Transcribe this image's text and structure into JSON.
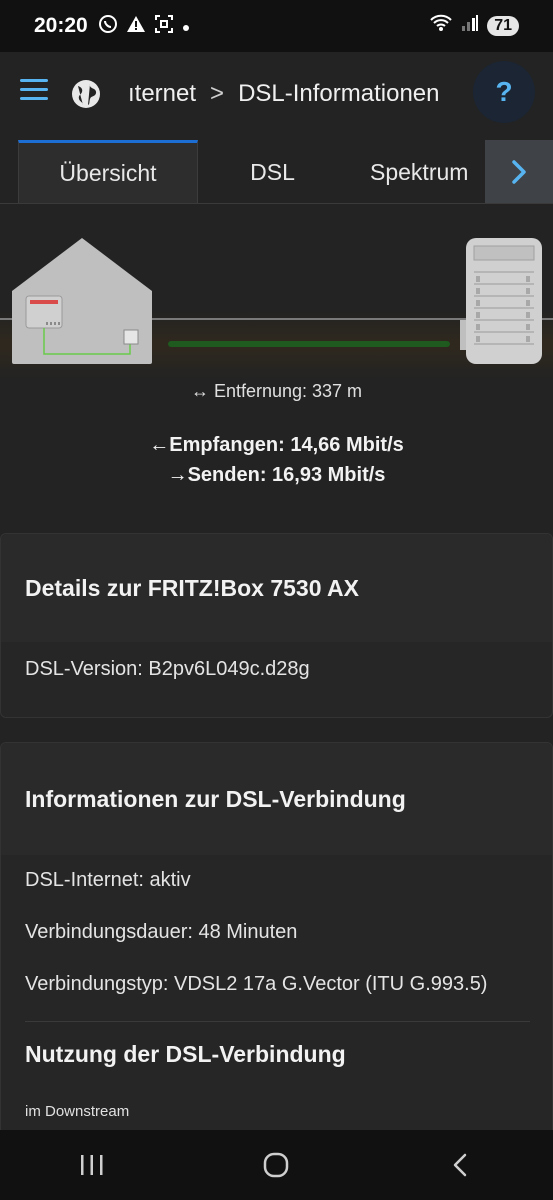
{
  "status_bar": {
    "time": "20:20",
    "battery": "71",
    "icons": [
      "whatsapp-icon",
      "warning-icon",
      "screenshot-icon",
      "dot-icon",
      "wifi-icon",
      "signal-icon",
      "battery-icon"
    ]
  },
  "header": {
    "breadcrumb_parent": "ıternet",
    "breadcrumb_separator": ">",
    "breadcrumb_current": "DSL-Informationen",
    "help_label": "?"
  },
  "tabs": [
    {
      "label": "Übersicht",
      "active": true
    },
    {
      "label": "DSL",
      "active": false
    },
    {
      "label": "Spektrum",
      "active": false
    }
  ],
  "diagram": {
    "distance": "↔ Entfernung: 337 m",
    "receive": "←Empfangen: 14,66 Mbit/s",
    "send": "→Senden: 16,93 Mbit/s",
    "line_color": "#1f5a1f",
    "led_color": "#d94a4a"
  },
  "card_details": {
    "title": "Details zur FRITZ!Box 7530 AX",
    "dsl_version": "DSL-Version: B2pv6L049c.d28g"
  },
  "card_connection": {
    "title": "Informationen zur DSL-Verbindung",
    "internet": "DSL-Internet: aktiv",
    "duration": "Verbindungsdauer: 48 Minuten",
    "type": "Verbindungstyp: VDSL2 17a G.Vector (ITU G.993.5)",
    "usage_title": "Nutzung der DSL-Verbindung",
    "downstream": "im Downstream"
  },
  "colors": {
    "accent": "#58b4f0",
    "tab_indicator": "#1c6ed4",
    "background": "#232323"
  }
}
